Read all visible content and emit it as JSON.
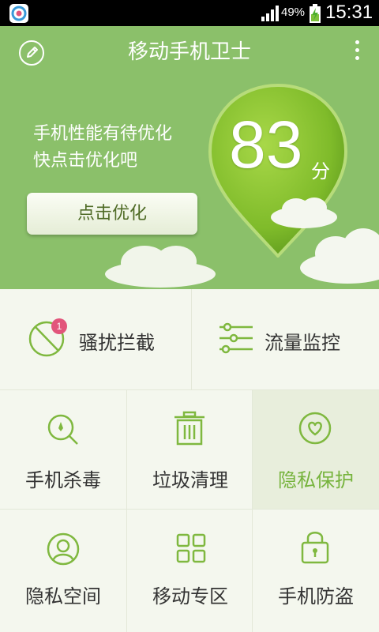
{
  "status_bar": {
    "battery_percent": "49%",
    "time": "15:31"
  },
  "header": {
    "title": "移动手机卫士"
  },
  "hero": {
    "status_line1": "手机性能有待优化",
    "status_line2": "快点击优化吧",
    "optimize_button": "点击优化",
    "score": "83",
    "score_unit": "分"
  },
  "features": {
    "row1": [
      {
        "label": "骚扰拦截",
        "badge": "1",
        "icon": "block-icon"
      },
      {
        "label": "流量监控",
        "icon": "sliders-icon"
      }
    ],
    "row2": [
      {
        "label": "手机杀毒",
        "icon": "scan-icon"
      },
      {
        "label": "垃圾清理",
        "icon": "trash-icon"
      },
      {
        "label": "隐私保护",
        "icon": "heart-shield-icon"
      }
    ],
    "row3": [
      {
        "label": "隐私空间",
        "icon": "user-icon"
      },
      {
        "label": "移动专区",
        "icon": "apps-grid-icon"
      },
      {
        "label": "手机防盗",
        "icon": "lock-icon"
      }
    ]
  },
  "colors": {
    "accent": "#76b33c",
    "hero_bg": "#8bc06a",
    "badge": "#e2557b"
  }
}
